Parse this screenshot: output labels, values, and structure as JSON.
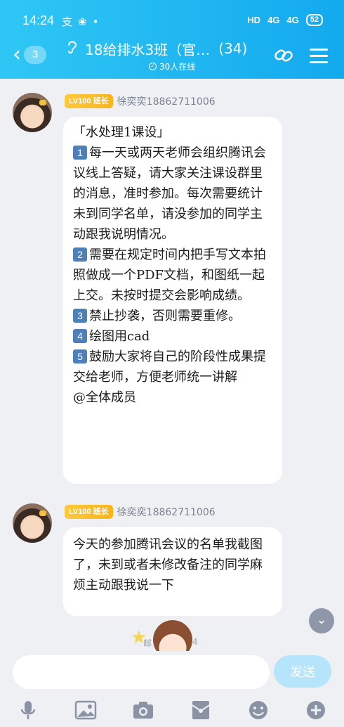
{
  "status_bar": {
    "time": "14:24",
    "left_icons": [
      "支",
      "❀",
      "•"
    ],
    "network": "HD",
    "sig1": "4G",
    "sig2": "4G",
    "battery": "52"
  },
  "header": {
    "unread_count": "3",
    "title": "18给排水3班（官…",
    "member_count": "(34)",
    "online_text": "30人在线"
  },
  "messages": [
    {
      "badge": "LV100 班长",
      "sender": "徐奕奕18862711006",
      "paragraphs": [
        {
          "num": "",
          "text": "「水处理1课设」"
        },
        {
          "num": "1",
          "text": "每一天或两天老师会组织腾讯会议线上答疑，请大家关注课设群里的消息，准时参加。每次需要统计未到同学名单，请没参加的同学主动跟我说明情况。"
        },
        {
          "num": "2",
          "text": "需要在规定时间内把手写文本拍照做成一个PDF文档，和图纸一起上交。未按时提交会影响成绩。"
        },
        {
          "num": "3",
          "text": "禁止抄袭，否则需要重修。"
        },
        {
          "num": "4",
          "text": "绘图用cad"
        },
        {
          "num": "5",
          "text": "鼓励大家将自己的阶段性成果提交给老师，方便老师统一讲解"
        },
        {
          "num": "",
          "text": "@全体成员"
        }
      ]
    },
    {
      "badge": "LV100 班长",
      "sender": "徐奕奕18862711006",
      "text": "今天的参加腾讯会议的名单我截图了，未到或者未修改备注的同学麻烦主动跟我说一下"
    }
  ],
  "floating": {
    "tag_left": "邮",
    "tag_right": "4"
  },
  "input": {
    "placeholder": "",
    "send_label": "发送"
  },
  "toolbar_icons": [
    "microphone-icon",
    "image-icon",
    "camera-icon",
    "red-packet-icon",
    "emoji-icon",
    "plus-icon"
  ],
  "colors": {
    "header_start": "#2fc7f5",
    "header_end": "#13a9ee",
    "badge": "#fbbd28",
    "send_disabled": "#b6e4fb",
    "number_box": "#4d80b8"
  }
}
